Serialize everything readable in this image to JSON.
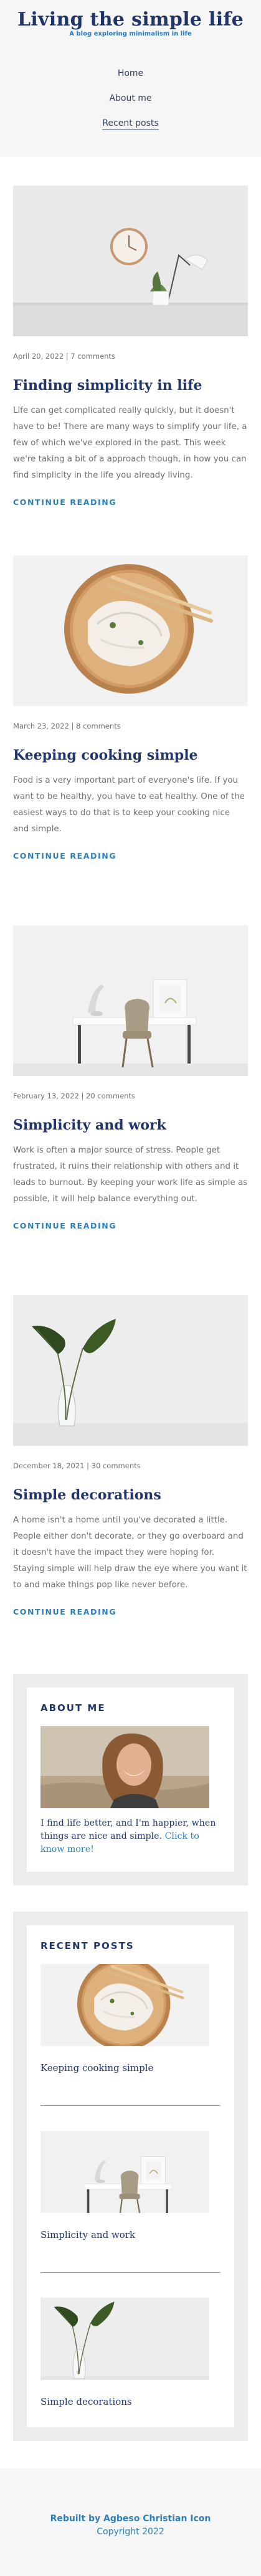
{
  "site": {
    "title": "Living the simple life",
    "tagline": "A blog exploring minimalism in life"
  },
  "nav": {
    "items": [
      "Home",
      "About me",
      "Recent posts"
    ],
    "active_index": 2
  },
  "posts": [
    {
      "image_icon": "wall-clock-and-lamp-photo",
      "meta": "April 20, 2022 | 7 comments",
      "title": "Finding simplicity in life",
      "excerpt": "Life can get complicated really quickly, but it doesn't have to be! There are many ways to simplify your life, a few of which we've explored in the past. This week we're taking a bit of a approach though, in how you can find simplicity in the life you already living.",
      "read_more": "CONTINUE READING"
    },
    {
      "image_icon": "dumplings-plate-photo",
      "meta": "March 23, 2022 | 8 comments",
      "title": "Keeping cooking simple",
      "excerpt": "Food is a very important part of everyone's life. If you want to be healthy, you have to eat healthy. One of the easiest ways to do that is to keep your cooking nice and simple.",
      "read_more": "CONTINUE READING"
    },
    {
      "image_icon": "desk-and-chair-photo",
      "meta": "February 13, 2022 | 20 comments",
      "title": "Simplicity and work",
      "excerpt": "Work is often a major source of stress. People get frustrated, it ruins their relationship with others and it leads to burnout. By keeping your work life as simple as possible, it will help balance everything out.",
      "read_more": "CONTINUE READING"
    },
    {
      "image_icon": "plant-in-vase-photo",
      "meta": "December 18, 2021 | 30 comments",
      "title": "Simple decorations",
      "excerpt": "A home isn't a home until you've decorated a little. People either don't decorate, or they go overboard and it doesn't have the impact they were hoping for. Staying simple will help draw the eye where you want it to and make things pop like never before.",
      "read_more": "CONTINUE READING"
    }
  ],
  "about": {
    "title": "ABOUT ME",
    "text": "I find life better, and I'm happier, when things are nice and simple. ",
    "link": "Click to know more!"
  },
  "recent": {
    "title": "RECENT POSTS",
    "items": [
      "Keeping cooking simple",
      "Simplicity and work",
      "Simple decorations"
    ]
  },
  "footer": {
    "credit": "Rebuilt by Agbeso Christian Icon",
    "copyright": "Copyright 2022"
  },
  "colors": {
    "navy": "#20356a",
    "link_blue": "#2e7fb8",
    "header_bg": "#f6f6f6",
    "widget_bg": "#ececec"
  }
}
